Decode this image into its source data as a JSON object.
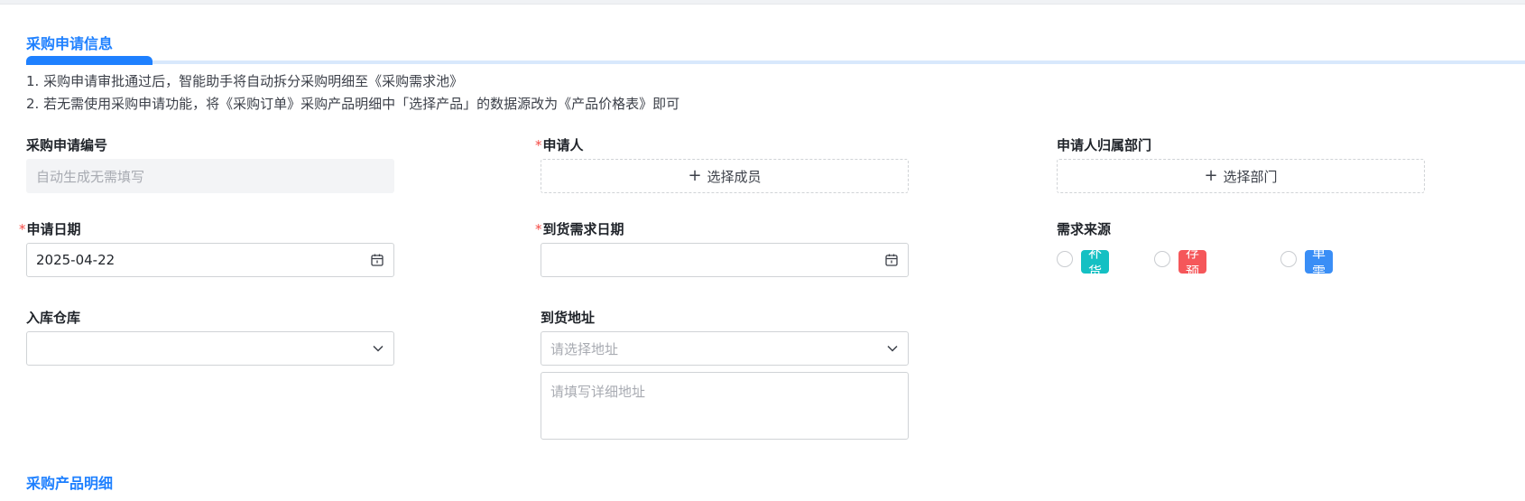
{
  "section1": {
    "title": "采购申请信息",
    "notes": [
      "1. 采购申请审批通过后，智能助手将自动拆分采购明细至《采购需求池》",
      "2. 若无需使用采购申请功能，将《采购订单》采购产品明细中「选择产品」的数据源改为《产品价格表》即可"
    ]
  },
  "fields": {
    "request_no": {
      "label": "采购申请编号",
      "placeholder": "自动生成无需填写"
    },
    "applicant": {
      "required_mark": "*",
      "label": "申请人",
      "button": "选择成员"
    },
    "department": {
      "label": "申请人归属部门",
      "button": "选择部门"
    },
    "apply_date": {
      "required_mark": "*",
      "label": "申请日期",
      "value": "2025-04-22"
    },
    "arrival_date": {
      "required_mark": "*",
      "label": "到货需求日期",
      "value": ""
    },
    "demand_source": {
      "label": "需求来源",
      "options": [
        {
          "label": "补货",
          "color": "#14c0c3"
        },
        {
          "label": "库存预警",
          "color": "#f5575a"
        },
        {
          "label": "工单需求",
          "color": "#3a8ef6"
        }
      ]
    },
    "warehouse": {
      "label": "入库仓库",
      "value": ""
    },
    "address": {
      "label": "到货地址",
      "placeholder": "请选择地址",
      "detail_placeholder": "请填写详细地址"
    }
  },
  "section2": {
    "title": "采购产品明细"
  },
  "colors": {
    "accent": "#1e80ff",
    "required": "#f54a45"
  }
}
